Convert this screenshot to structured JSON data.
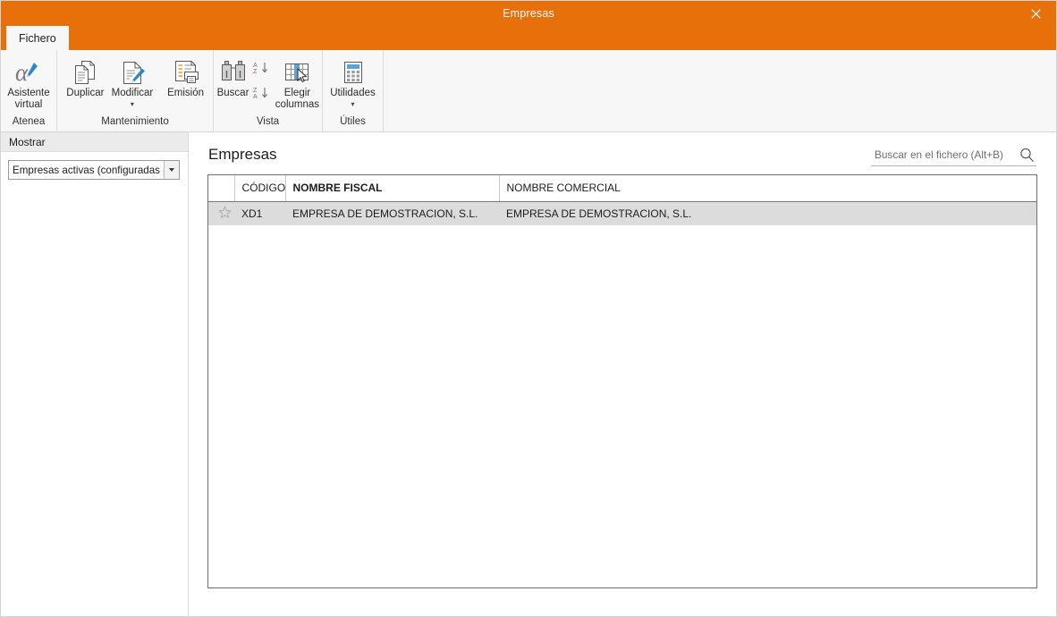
{
  "window": {
    "title": "Empresas",
    "close_label": "✕",
    "accent_color": "#e8700a"
  },
  "tabs": [
    {
      "label": "Fichero",
      "active": true
    }
  ],
  "ribbon": {
    "groups": [
      {
        "name": "atenea",
        "label": "Atenea",
        "buttons": [
          {
            "name": "asistente-virtual",
            "label": "Asistente virtual",
            "icon": "alpha-pen-icon",
            "caret": false
          }
        ]
      },
      {
        "name": "mantenimiento",
        "label": "Mantenimiento",
        "buttons": [
          {
            "name": "duplicar",
            "label": "Duplicar",
            "icon": "copy-documents-icon",
            "caret": false
          },
          {
            "name": "modificar",
            "label": "Modificar",
            "icon": "document-pencil-icon",
            "caret": true
          },
          {
            "name": "emision",
            "label": "Emisión",
            "icon": "document-printer-icon",
            "caret": false
          }
        ]
      },
      {
        "name": "vista",
        "label": "Vista",
        "buttons": [
          {
            "name": "buscar",
            "label": "Buscar",
            "icon": "binoculars-icon",
            "caret": false
          },
          {
            "name": "elegir-columnas",
            "label": "Elegir columnas",
            "icon": "columns-cursor-icon",
            "caret": false
          }
        ],
        "sort_buttons": [
          {
            "name": "sort-ascending",
            "icon": "sort-a-z-icon"
          },
          {
            "name": "sort-descending",
            "icon": "sort-z-a-icon"
          }
        ]
      },
      {
        "name": "utiles",
        "label": "Útiles",
        "buttons": [
          {
            "name": "utilidades",
            "label": "Utilidades",
            "icon": "calculator-icon",
            "caret": true
          }
        ]
      }
    ]
  },
  "sidebar": {
    "header": "Mostrar",
    "filter": {
      "selected": "Empresas activas (configuradas pa",
      "full_text": "Empresas activas (configuradas para este usuario)"
    }
  },
  "main": {
    "title": "Empresas",
    "search": {
      "placeholder": "Buscar en el fichero (Alt+B)",
      "value": ""
    },
    "grid": {
      "columns": [
        {
          "key": "star",
          "label": "",
          "bold": false
        },
        {
          "key": "codigo",
          "label": "CÓDIGO",
          "bold": false
        },
        {
          "key": "nombre_fiscal",
          "label": "NOMBRE FISCAL",
          "bold": true
        },
        {
          "key": "nombre_comercial",
          "label": "NOMBRE COMERCIAL",
          "bold": false
        }
      ],
      "rows": [
        {
          "selected": true,
          "favorite": false,
          "star": "☆",
          "codigo": "XD1",
          "nombre_fiscal": "EMPRESA DE DEMOSTRACION, S.L.",
          "nombre_comercial": "EMPRESA DE DEMOSTRACION, S.L."
        }
      ]
    }
  }
}
